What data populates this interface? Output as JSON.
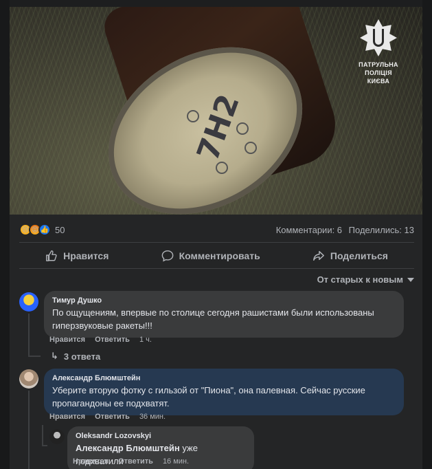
{
  "photo": {
    "logo_text_line1": "ПАТРУЛЬНА ПОЛІЦІЯ",
    "logo_text_line2": "КИЄВА",
    "shell_marking": "7Н2",
    "colors": {
      "grass": "#47463c",
      "shell_rim": "#b5ac8c"
    }
  },
  "reactions": {
    "icons": [
      "sad-reaction-icon",
      "angry-reaction-icon",
      "like-reaction-icon"
    ],
    "count": "50",
    "comments": "Комментарии: 6",
    "shares": "Поделились: 13"
  },
  "actions": {
    "like": "Нравится",
    "comment": "Комментировать",
    "share": "Поделиться"
  },
  "sort": {
    "label": "От старых к новым"
  },
  "comments": [
    {
      "author": "Тимур Душко",
      "text": "По ощущениям, впервые по столице сегодня рашистами были использованы гиперзвуковые ракеты!!!",
      "like": "Нравится",
      "reply": "Ответить",
      "time": "1 ч.",
      "replies_label": "3 ответа"
    },
    {
      "author": "Александр Блюмштейн",
      "text": "Уберите вторую фотку с гильзой от \"Пиона\", она палевная. Сейчас русские пропагандоны ее подхватят.",
      "like": "Нравится",
      "reply": "Ответить",
      "time": "36 мин.",
      "reply_item": {
        "author": "Oleksandr Lozovskyi",
        "mention": "Александр Блюмштейн",
        "text": " уже подхватили",
        "like": "Нравится",
        "reply": "Ответить",
        "time": "16 мин."
      }
    }
  ],
  "colors": {
    "background": "#18191a",
    "card": "#242526",
    "bubble": "#3a3b3c",
    "bubble_highlight": "#263951",
    "muted_text": "#b0b3b8",
    "like_blue": "#1877f2"
  }
}
